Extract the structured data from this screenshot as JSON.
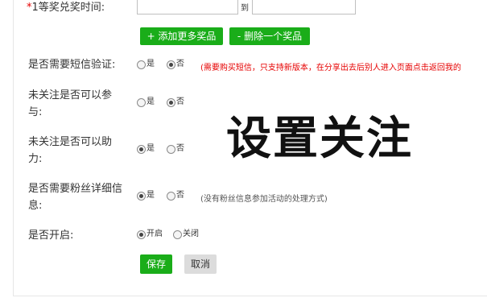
{
  "form": {
    "first_prize_time": {
      "star": "*",
      "label": "1等奖兑奖时间:",
      "to": "到",
      "start_value": "",
      "end_value": ""
    },
    "add_more_label": "+ 添加更多奖品",
    "delete_one_label": "- 删除一个奖品",
    "sms_verify": {
      "label": "是否需要短信验证:",
      "yes": "是",
      "no": "否",
      "selected": "no",
      "hint": "(需要购买短信，只支持新版本，在分享出去后别人进入页面点击返回我的"
    },
    "unfollow_join": {
      "label_line1": "未关注是否可以参",
      "label_line2": "与:",
      "yes": "是",
      "no": "否",
      "selected": "no"
    },
    "unfollow_help": {
      "label_line1": "未关注是否可以助",
      "label_line2": "力:",
      "yes": "是",
      "no": "否",
      "selected": "yes"
    },
    "fan_detail": {
      "label_line1": "是否需要粉丝详细信",
      "label_line2": "息:",
      "yes": "是",
      "no": "否",
      "selected": "yes",
      "hint": "(没有粉丝信息参加活动的处理方式)"
    },
    "enable": {
      "label": "是否开启:",
      "on": "开启",
      "off": "关闭",
      "selected": "on"
    },
    "save_label": "保存",
    "cancel_label": "取消"
  },
  "overlay": {
    "text": "设置关注"
  },
  "colors": {
    "primary_green": "#1aad19",
    "warning_red": "#e60000",
    "cancel_gray": "#dcdcdc"
  }
}
